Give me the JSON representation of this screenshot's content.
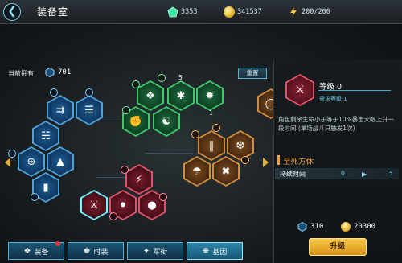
{
  "header": {
    "back_icon": "back-arrow-icon",
    "title": "装备室",
    "resources": [
      {
        "icon": "green-gem-icon",
        "value": "3353",
        "color": "#3ee8a6"
      },
      {
        "icon": "gold-coin-icon",
        "value": "341537",
        "color": "#e0a91c"
      },
      {
        "icon": "energy-bolt-icon",
        "value": "200/200",
        "color": "#f0c53a"
      }
    ]
  },
  "left": {
    "owned_label": "当前拥有",
    "owned_value": "701",
    "reset_label": "重置"
  },
  "tree_levels": {
    "green_top": "5",
    "green_right": "1"
  },
  "detail": {
    "level_text": "等级 0",
    "requirement": "需求等级 1",
    "description": "角色剩余生命小于等于10%暴击大幅上升一段时间.(单场战斗只触发1次)",
    "skill_name": "至死方休",
    "duration_label": "持续时间",
    "duration_from": "0",
    "duration_to": "5",
    "cost_crystal": "310",
    "cost_gold": "20300",
    "upgrade_label": "升级"
  },
  "tabs": [
    {
      "label": "装备",
      "icon": "equipment-icon",
      "badge": true
    },
    {
      "label": "时装",
      "icon": "costume-icon",
      "badge": false
    },
    {
      "label": "军衔",
      "icon": "rank-icon",
      "badge": false
    },
    {
      "label": "基因",
      "icon": "gene-icon",
      "badge": false,
      "active": true
    }
  ],
  "colors": {
    "accent": "#6fd2e8",
    "upgrade": "#f5c648",
    "skill_title": "#f1a234",
    "red_branch": "#e0546a",
    "green_branch": "#3ec96b",
    "orange_branch": "#d38d3a",
    "blue_branch": "#4fa3d8"
  }
}
